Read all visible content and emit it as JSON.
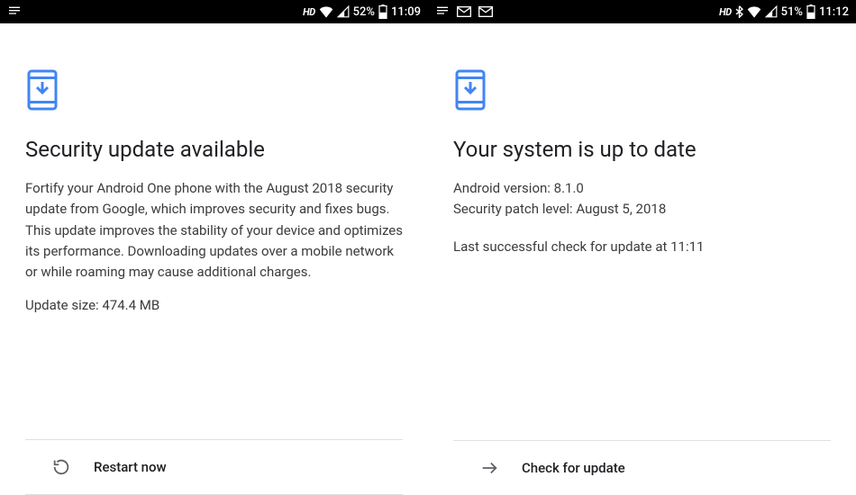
{
  "left": {
    "status": {
      "battery_pct": "52%",
      "time": "11:09",
      "hd": "HD"
    },
    "title": "Security update available",
    "body": "Fortify your Android One phone with the August 2018 security update from Google, which improves security and fixes bugs. This update improves the stability of your device and optimizes its performance. Downloading updates over a mobile network or while roaming may cause additional charges.",
    "update_size": "Update size: 474.4 MB",
    "action_label": "Restart now"
  },
  "right": {
    "status": {
      "battery_pct": "51%",
      "time": "11:12",
      "hd": "HD"
    },
    "title": "Your system is up to date",
    "android_version": "Android version: 8.1.0",
    "security_patch": "Security patch level: August 5, 2018",
    "last_check": "Last successful check for update at 11:11",
    "action_label": "Check for update"
  }
}
